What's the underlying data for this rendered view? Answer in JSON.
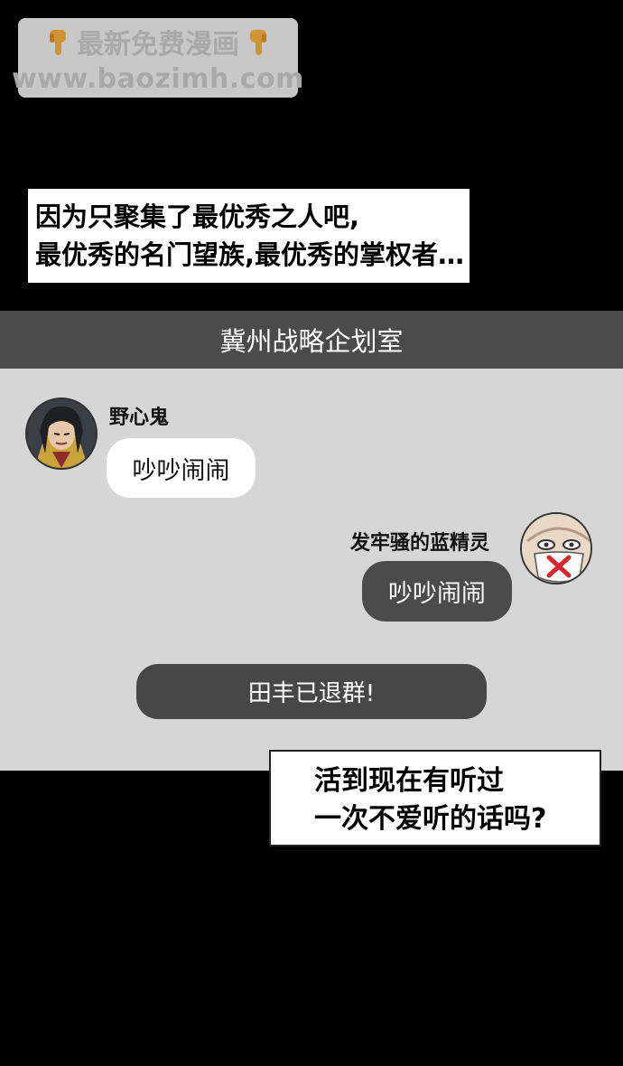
{
  "watermark": {
    "line1": "最新免费漫画",
    "line2": "www.baozimh.com",
    "icon": "pointing-down-hand-icon"
  },
  "caption_top": {
    "line1": "因为只聚集了最优秀之人吧,",
    "line2": "最优秀的名门望族,最优秀的掌权者…"
  },
  "chat": {
    "title": "冀州战略企划室",
    "messages": [
      {
        "sender": "野心鬼",
        "text": "吵吵闹闹",
        "side": "left"
      },
      {
        "sender": "发牢骚的蓝精灵",
        "text": "吵吵闹闹",
        "side": "right"
      }
    ],
    "system_message": "田丰已退群!"
  },
  "caption_bottom": {
    "line1": "活到现在有听过",
    "line2": "一次不爱听的话吗?"
  },
  "colors": {
    "background": "#000000",
    "chat_header": "#4b4b4b",
    "chat_body": "#d6d6d6",
    "bubble_dark": "#4b4b4b",
    "bubble_light": "#ffffff"
  }
}
